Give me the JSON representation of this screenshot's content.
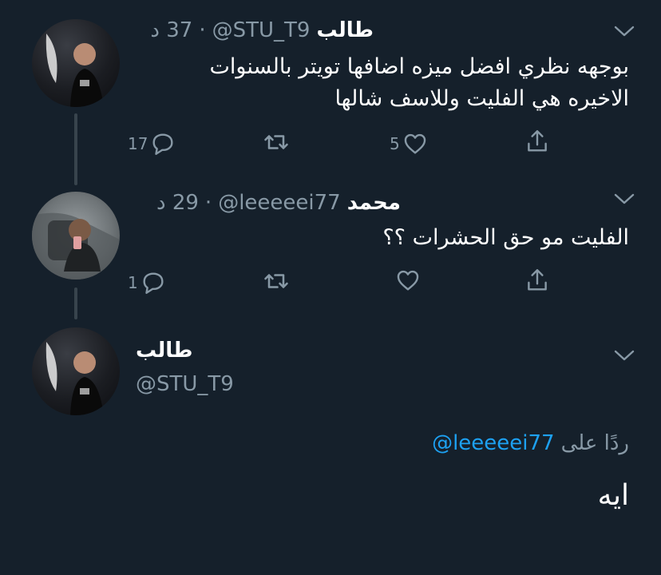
{
  "tweet1": {
    "display_name": "طالب",
    "handle": "@STU_T9",
    "time": "37 د",
    "dot": "·",
    "lines": [
      "بوجهه نظري افضل ميزه اضافها تويتر بالسنوات",
      "الاخيره هي الفليت وللاسف شالها"
    ],
    "replies": "17",
    "likes": "5"
  },
  "tweet2": {
    "display_name": "محمد",
    "handle": "@leeeeei77",
    "time": "29 د",
    "dot": "·",
    "text": "الفليت مو حق الحشرات ؟؟",
    "replies": "1"
  },
  "tweet3": {
    "display_name": "طالب",
    "handle": "@STU_T9",
    "reply_prefix": "ردًا على",
    "reply_to": "@leeeeei77",
    "text": "ايه"
  },
  "icons": [
    "reply-icon",
    "retweet-icon",
    "like-icon",
    "share-icon",
    "chevron-down-icon"
  ],
  "colors": {
    "background": "#15202b",
    "muted": "#8899a6",
    "link": "#1da1f2",
    "line": "#38444d"
  }
}
